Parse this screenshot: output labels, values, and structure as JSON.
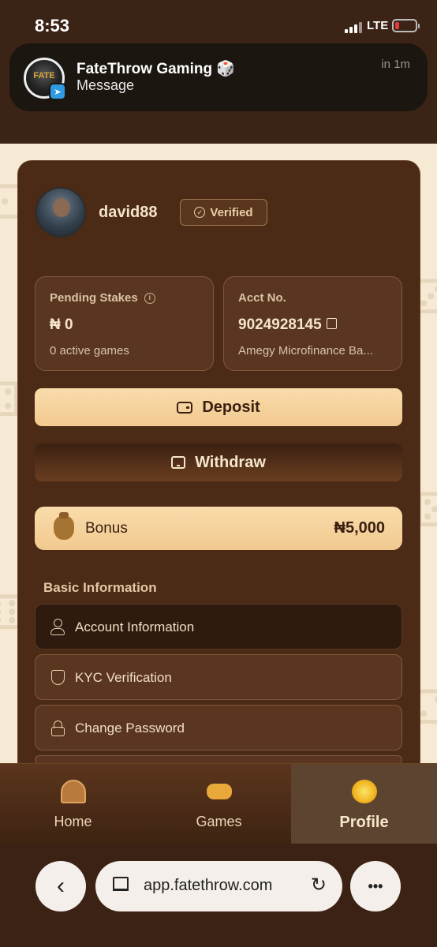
{
  "status_bar": {
    "time": "8:53",
    "network": "LTE"
  },
  "notification": {
    "title": "FateThrow Gaming 🎲",
    "message": "Message",
    "time": "in 1m",
    "avatar_text": "FATE"
  },
  "profile": {
    "username": "david88",
    "verified_label": "Verified"
  },
  "stats": {
    "pending": {
      "label": "Pending Stakes",
      "value": "₦ 0",
      "sub": "0 active games"
    },
    "account": {
      "label": "Acct No.",
      "value": "9024928145",
      "sub": "Amegy Microfinance Ba..."
    }
  },
  "actions": {
    "deposit_label": "Deposit",
    "withdraw_label": "Withdraw"
  },
  "bonus": {
    "label": "Bonus",
    "amount": "₦5,000"
  },
  "basic_info": {
    "title": "Basic Information",
    "items": [
      {
        "label": "Account Information"
      },
      {
        "label": "KYC Verification"
      },
      {
        "label": "Change Password"
      }
    ]
  },
  "bottom_nav": {
    "items": [
      {
        "label": "Home"
      },
      {
        "label": "Games"
      },
      {
        "label": "Profile"
      }
    ],
    "active": "Profile"
  },
  "browser": {
    "url": "app.fatethrow.com",
    "back_icon": "‹",
    "more_icon": "•••",
    "reload_icon": "↻"
  },
  "colors": {
    "background": "#3b2315",
    "card": "#4b2a16",
    "accent": "#f2c98f",
    "cream": "#f7ead5"
  }
}
